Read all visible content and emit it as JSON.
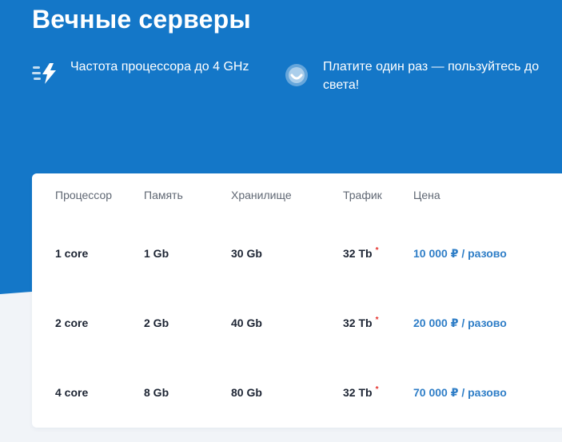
{
  "page": {
    "title": "Вечные серверы",
    "colors": {
      "hero_blue": "#1477c8",
      "card_bg": "#ffffff",
      "page_bg": "#f1f4f8",
      "price_blue": "#2f7ec7",
      "asterisk_red": "#e5322d",
      "text_dark": "#1c2433",
      "text_muted": "#5f6773"
    }
  },
  "features": [
    {
      "icon": "lightning-speed-icon",
      "text": "Частота процессора до 4 GHz"
    },
    {
      "icon": "smile-icon",
      "text_line1": "Платите один раз — пользуйтесь до",
      "text_line2": "света!"
    }
  ],
  "table": {
    "headers": [
      "Процессор",
      "Память",
      "Хранилище",
      "Трафик",
      "Цена"
    ],
    "rows": [
      {
        "cpu": "1 core",
        "memory": "1 Gb",
        "storage": "30 Gb",
        "traffic": "32 Tb",
        "traffic_mark": "*",
        "price": "10 000 ₽ / разово"
      },
      {
        "cpu": "2 core",
        "memory": "2 Gb",
        "storage": "40 Gb",
        "traffic": "32 Tb",
        "traffic_mark": "*",
        "price": "20 000 ₽ / разово"
      },
      {
        "cpu": "4 core",
        "memory": "8 Gb",
        "storage": "80 Gb",
        "traffic": "32 Tb",
        "traffic_mark": "*",
        "price": "70 000 ₽ / разово"
      }
    ]
  }
}
